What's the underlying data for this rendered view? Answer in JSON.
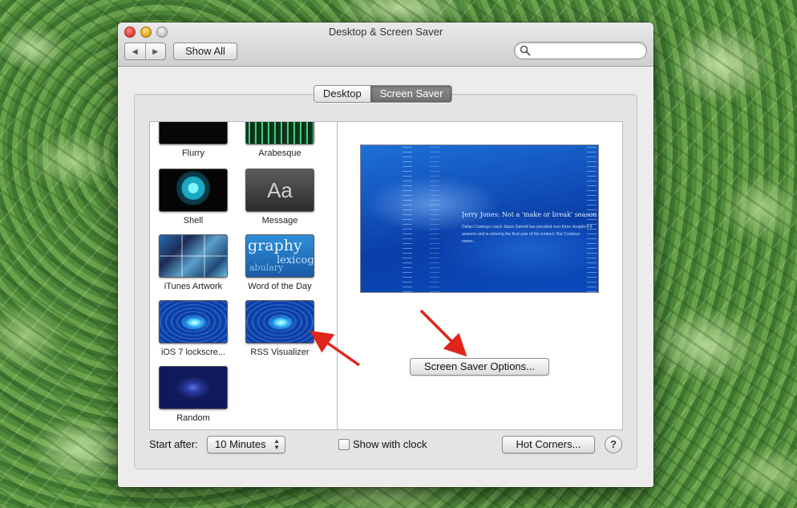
{
  "window": {
    "title": "Desktop & Screen Saver",
    "nav_back": "◀",
    "nav_forward": "▶",
    "show_all": "Show All",
    "search_placeholder": ""
  },
  "tabs": [
    {
      "label": "Desktop",
      "active": false
    },
    {
      "label": "Screen Saver",
      "active": true
    }
  ],
  "screensavers": [
    {
      "name": "Flurry",
      "icon": "flurry-thumb"
    },
    {
      "name": "Arabesque",
      "icon": "arabesque-thumb"
    },
    {
      "name": "Shell",
      "icon": "shell-thumb"
    },
    {
      "name": "Message",
      "icon": "message-thumb",
      "thumb_text": "Aa"
    },
    {
      "name": "iTunes Artwork",
      "icon": "itunes-artwork-thumb"
    },
    {
      "name": "Word of the Day",
      "icon": "word-of-the-day-thumb",
      "thumb_words": [
        "graphy",
        "lexicog",
        "abulary"
      ]
    },
    {
      "name": "iOS 7 lockscre...",
      "icon": "ios7-lockscreen-thumb"
    },
    {
      "name": "RSS Visualizer",
      "icon": "rss-visualizer-thumb",
      "selected": true
    },
    {
      "name": "Random",
      "icon": "random-thumb"
    }
  ],
  "preview": {
    "headline": "Jerry Jones: Not a 'make or break' season for",
    "body": "Dallas Cowboys coach Jason Garrett has presided over three straight 8-8 seasons and is entering the final year of his contract. But Cowboys owner..."
  },
  "buttons": {
    "options": "Screen Saver Options...",
    "hot_corners": "Hot Corners...",
    "help": "?"
  },
  "start_after": {
    "label": "Start after:",
    "value": "10 Minutes"
  },
  "show_with_clock": {
    "label": "Show with clock",
    "checked": false
  },
  "annotation_color": "#e0261c"
}
